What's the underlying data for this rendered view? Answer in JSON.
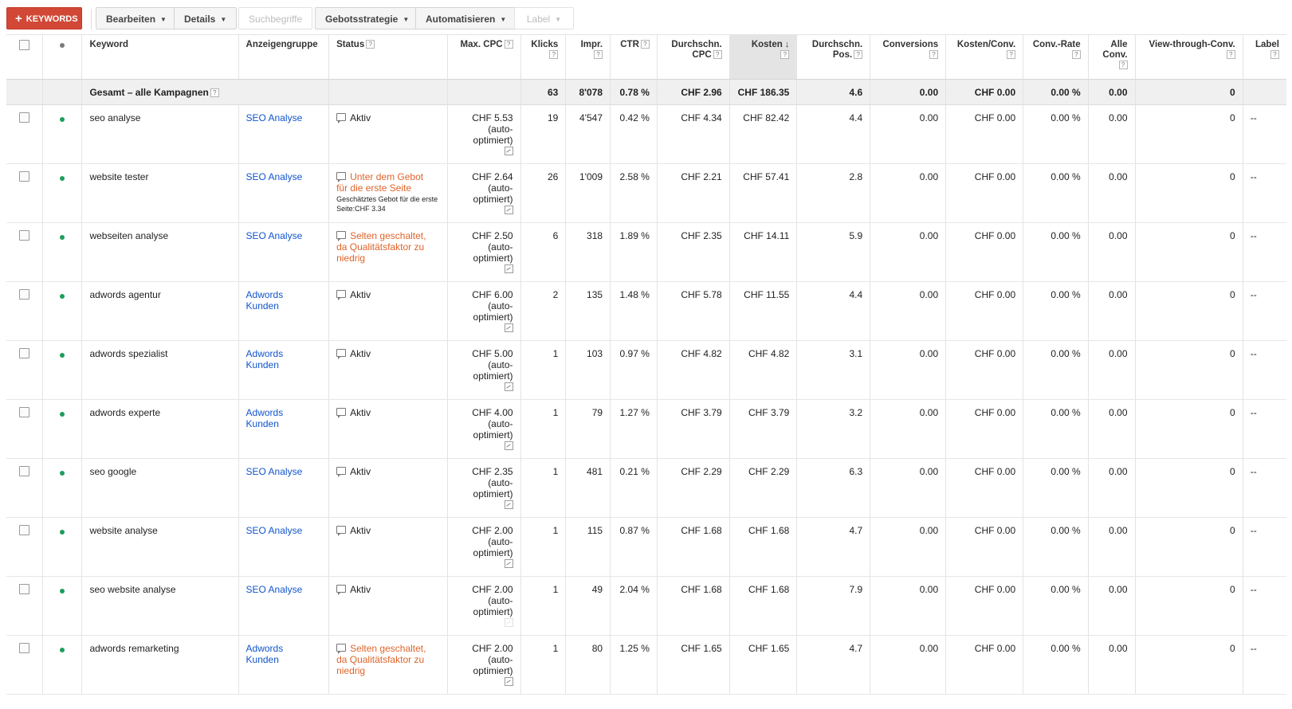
{
  "toolbar": {
    "keywords_label": "KEYWORDS",
    "edit_label": "Bearbeiten",
    "details_label": "Details",
    "search_terms_label": "Suchbegriffe",
    "bid_strategy_label": "Gebotsstrategie",
    "automate_label": "Automatisieren",
    "label_label": "Label"
  },
  "columns": {
    "keyword": "Keyword",
    "adgroup": "Anzeigengruppe",
    "status": "Status",
    "max_cpc": "Max. CPC",
    "clicks": "Klicks",
    "impr": "Impr.",
    "ctr": "CTR",
    "avg_cpc_1": "Durchschn.",
    "avg_cpc_2": "CPC",
    "cost": "Kosten",
    "avg_pos_1": "Durchschn.",
    "avg_pos_2": "Pos.",
    "conversions": "Conversions",
    "cost_conv": "Kosten/Conv.",
    "conv_rate": "Conv.-Rate",
    "all_conv_1": "Alle",
    "all_conv_2": "Conv.",
    "view_through": "View-through-Conv.",
    "label": "Label"
  },
  "total": {
    "label": "Gesamt – alle Kampagnen",
    "clicks": "63",
    "impr": "8'078",
    "ctr": "0.78 %",
    "avg_cpc": "CHF 2.96",
    "cost": "CHF 186.35",
    "avg_pos": "4.6",
    "conversions": "0.00",
    "cost_conv": "CHF 0.00",
    "conv_rate": "0.00 %",
    "all_conv": "0.00",
    "view_through": "0"
  },
  "auto_note_1": "(auto-",
  "auto_note_2": "optimiert)",
  "rows": [
    {
      "keyword": "seo analyse",
      "adgroup_1": "SEO Analyse",
      "adgroup_2": "",
      "status_1": "Aktiv",
      "status_2": "",
      "status_3": "",
      "status_sub": "",
      "warn": false,
      "max_cpc": "CHF 5.53",
      "clicks": "19",
      "impr": "4'547",
      "ctr": "0.42 %",
      "avg_cpc": "CHF 4.34",
      "cost": "CHF 82.42",
      "avg_pos": "4.4",
      "conversions": "0.00",
      "cost_conv": "CHF 0.00",
      "conv_rate": "0.00 %",
      "all_conv": "0.00",
      "view_through": "0",
      "label": "--"
    },
    {
      "keyword": "website tester",
      "adgroup_1": "SEO Analyse",
      "adgroup_2": "",
      "status_1": "Unter dem Gebot",
      "status_2": "für die erste Seite",
      "status_3": "",
      "status_sub": "Geschätztes Gebot für die erste Seite:CHF 3.34",
      "warn": true,
      "max_cpc": "CHF 2.64",
      "clicks": "26",
      "impr": "1'009",
      "ctr": "2.58 %",
      "avg_cpc": "CHF 2.21",
      "cost": "CHF 57.41",
      "avg_pos": "2.8",
      "conversions": "0.00",
      "cost_conv": "CHF 0.00",
      "conv_rate": "0.00 %",
      "all_conv": "0.00",
      "view_through": "0",
      "label": "--"
    },
    {
      "keyword": "webseiten analyse",
      "adgroup_1": "SEO Analyse",
      "adgroup_2": "",
      "status_1": "Selten geschaltet,",
      "status_2": "da Qualitätsfaktor zu",
      "status_3": "niedrig",
      "status_sub": "",
      "warn": true,
      "max_cpc": "CHF 2.50",
      "clicks": "6",
      "impr": "318",
      "ctr": "1.89 %",
      "avg_cpc": "CHF 2.35",
      "cost": "CHF 14.11",
      "avg_pos": "5.9",
      "conversions": "0.00",
      "cost_conv": "CHF 0.00",
      "conv_rate": "0.00 %",
      "all_conv": "0.00",
      "view_through": "0",
      "label": "--"
    },
    {
      "keyword": "adwords agentur",
      "adgroup_1": "Adwords",
      "adgroup_2": "Kunden",
      "status_1": "Aktiv",
      "status_2": "",
      "status_3": "",
      "status_sub": "",
      "warn": false,
      "max_cpc": "CHF 6.00",
      "clicks": "2",
      "impr": "135",
      "ctr": "1.48 %",
      "avg_cpc": "CHF 5.78",
      "cost": "CHF 11.55",
      "avg_pos": "4.4",
      "conversions": "0.00",
      "cost_conv": "CHF 0.00",
      "conv_rate": "0.00 %",
      "all_conv": "0.00",
      "view_through": "0",
      "label": "--"
    },
    {
      "keyword": "adwords spezialist",
      "adgroup_1": "Adwords",
      "adgroup_2": "Kunden",
      "status_1": "Aktiv",
      "status_2": "",
      "status_3": "",
      "status_sub": "",
      "warn": false,
      "max_cpc": "CHF 5.00",
      "clicks": "1",
      "impr": "103",
      "ctr": "0.97 %",
      "avg_cpc": "CHF 4.82",
      "cost": "CHF 4.82",
      "avg_pos": "3.1",
      "conversions": "0.00",
      "cost_conv": "CHF 0.00",
      "conv_rate": "0.00 %",
      "all_conv": "0.00",
      "view_through": "0",
      "label": "--"
    },
    {
      "keyword": "adwords experte",
      "adgroup_1": "Adwords",
      "adgroup_2": "Kunden",
      "status_1": "Aktiv",
      "status_2": "",
      "status_3": "",
      "status_sub": "",
      "warn": false,
      "max_cpc": "CHF 4.00",
      "clicks": "1",
      "impr": "79",
      "ctr": "1.27 %",
      "avg_cpc": "CHF 3.79",
      "cost": "CHF 3.79",
      "avg_pos": "3.2",
      "conversions": "0.00",
      "cost_conv": "CHF 0.00",
      "conv_rate": "0.00 %",
      "all_conv": "0.00",
      "view_through": "0",
      "label": "--"
    },
    {
      "keyword": "seo google",
      "adgroup_1": "SEO Analyse",
      "adgroup_2": "",
      "status_1": "Aktiv",
      "status_2": "",
      "status_3": "",
      "status_sub": "",
      "warn": false,
      "max_cpc": "CHF 2.35",
      "clicks": "1",
      "impr": "481",
      "ctr": "0.21 %",
      "avg_cpc": "CHF 2.29",
      "cost": "CHF 2.29",
      "avg_pos": "6.3",
      "conversions": "0.00",
      "cost_conv": "CHF 0.00",
      "conv_rate": "0.00 %",
      "all_conv": "0.00",
      "view_through": "0",
      "label": "--"
    },
    {
      "keyword": "website analyse",
      "adgroup_1": "SEO Analyse",
      "adgroup_2": "",
      "status_1": "Aktiv",
      "status_2": "",
      "status_3": "",
      "status_sub": "",
      "warn": false,
      "max_cpc": "CHF 2.00",
      "clicks": "1",
      "impr": "115",
      "ctr": "0.87 %",
      "avg_cpc": "CHF 1.68",
      "cost": "CHF 1.68",
      "avg_pos": "4.7",
      "conversions": "0.00",
      "cost_conv": "CHF 0.00",
      "conv_rate": "0.00 %",
      "all_conv": "0.00",
      "view_through": "0",
      "label": "--"
    },
    {
      "keyword": "seo website analyse",
      "adgroup_1": "SEO Analyse",
      "adgroup_2": "",
      "status_1": "Aktiv",
      "status_2": "",
      "status_3": "",
      "status_sub": "",
      "warn": false,
      "max_cpc": "CHF 2.00",
      "clicks": "1",
      "impr": "49",
      "ctr": "2.04 %",
      "avg_cpc": "CHF 1.68",
      "cost": "CHF 1.68",
      "avg_pos": "7.9",
      "conversions": "0.00",
      "cost_conv": "CHF 0.00",
      "conv_rate": "0.00 %",
      "all_conv": "0.00",
      "view_through": "0",
      "label": "--"
    },
    {
      "keyword": "adwords remarketing",
      "adgroup_1": "Adwords",
      "adgroup_2": "Kunden",
      "status_1": "Selten geschaltet,",
      "status_2": "da Qualitätsfaktor zu",
      "status_3": "niedrig",
      "status_sub": "",
      "warn": true,
      "max_cpc": "CHF 2.00",
      "clicks": "1",
      "impr": "80",
      "ctr": "1.25 %",
      "avg_cpc": "CHF 1.65",
      "cost": "CHF 1.65",
      "avg_pos": "4.7",
      "conversions": "0.00",
      "cost_conv": "CHF 0.00",
      "conv_rate": "0.00 %",
      "all_conv": "0.00",
      "view_through": "0",
      "label": "--"
    }
  ]
}
